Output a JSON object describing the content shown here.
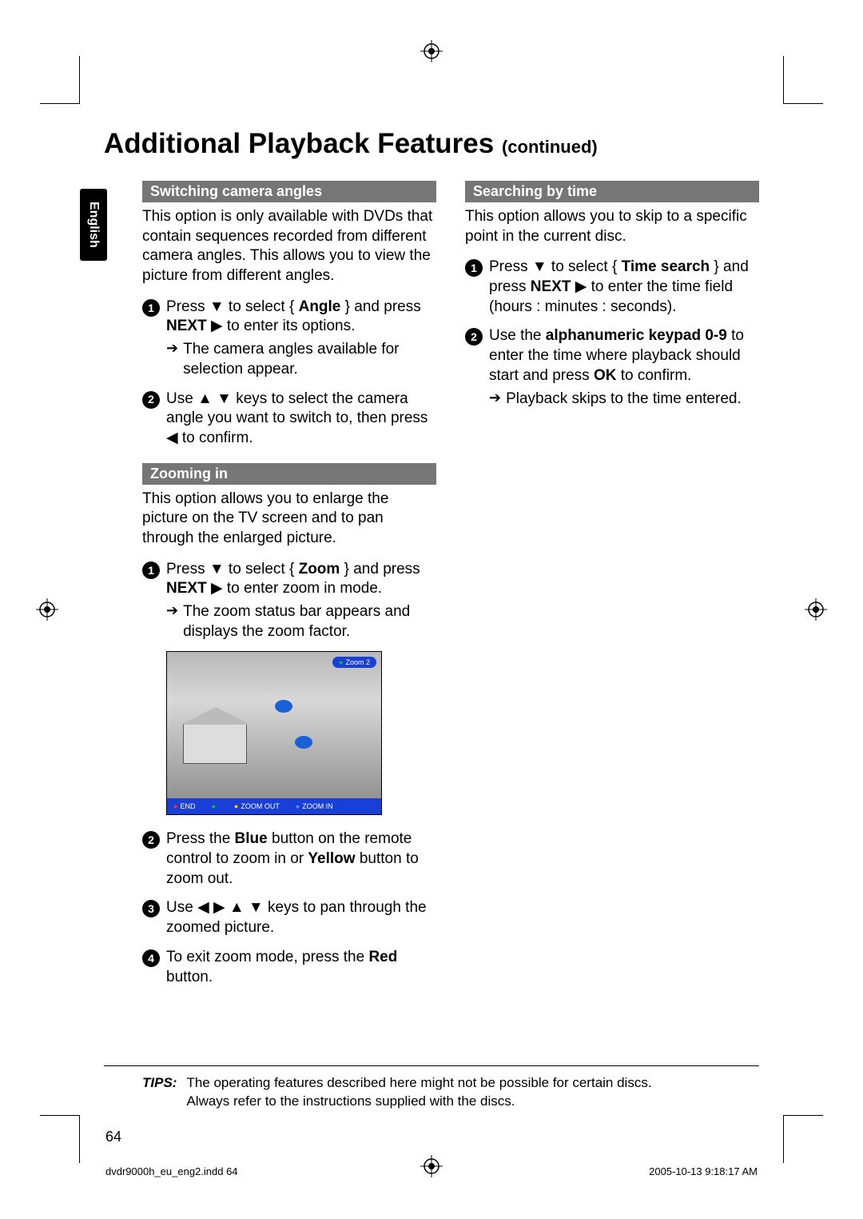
{
  "page": {
    "title_main": "Additional Playback Features",
    "title_cont": "(continued)",
    "language_tab": "English",
    "page_number": "64",
    "footer_file": "dvdr9000h_eu_eng2.indd   64",
    "footer_date": "2005-10-13   9:18:17 AM"
  },
  "tips": {
    "label": "TIPS:",
    "line1": "The operating features described here might not be possible for certain discs.",
    "line2": "Always refer to the instructions supplied with the discs."
  },
  "left": {
    "sec1_title": "Switching camera angles",
    "sec1_intro": "This option is only available with DVDs that contain sequences recorded from different camera angles. This allows you to view the picture from different angles.",
    "sec1_step1_a": "Press ▼ to select { ",
    "sec1_step1_b": "Angle",
    "sec1_step1_c": " } and press ",
    "sec1_step1_d": "NEXT",
    "sec1_step1_e": " ▶  to enter its options.",
    "sec1_step1_result": "The camera angles available for selection appear.",
    "sec1_step2": "Use ▲ ▼ keys to select the camera angle you want to switch to, then press ◀ to confirm.",
    "sec2_title": "Zooming in",
    "sec2_intro": "This option allows you to enlarge the picture on the TV screen and to pan through the enlarged picture.",
    "sec2_step1_a": "Press ▼ to select { ",
    "sec2_step1_b": "Zoom",
    "sec2_step1_c": " } and press ",
    "sec2_step1_d": "NEXT",
    "sec2_step1_e": " ▶  to enter zoom in mode.",
    "sec2_step1_result": "The zoom status bar appears and displays the zoom factor.",
    "zoom_badge": "Zoom 2",
    "zoom_end": "END",
    "zoom_out": "ZOOM OUT",
    "zoom_in": "ZOOM IN",
    "sec2_step2_a": "Press the ",
    "sec2_step2_b": "Blue",
    "sec2_step2_c": " button on the remote control to zoom in or ",
    "sec2_step2_d": "Yellow",
    "sec2_step2_e": " button to zoom out.",
    "sec2_step3": "Use ◀ ▶ ▲ ▼ keys to pan through the zoomed picture.",
    "sec2_step4_a": "To exit zoom mode, press the ",
    "sec2_step4_b": "Red",
    "sec2_step4_c": " button."
  },
  "right": {
    "sec1_title": "Searching by time",
    "sec1_intro": "This option allows you to skip to a specific point in the current disc.",
    "sec1_step1_a": "Press ▼ to select { ",
    "sec1_step1_b": "Time search",
    "sec1_step1_c": " } and press ",
    "sec1_step1_d": "NEXT",
    "sec1_step1_e": " ▶  to enter the time field (hours : minutes : seconds).",
    "sec1_step2_a": "Use the ",
    "sec1_step2_b": "alphanumeric keypad 0-9",
    "sec1_step2_c": " to enter the time where playback should start and press ",
    "sec1_step2_d": "OK",
    "sec1_step2_e": " to confirm.",
    "sec1_step2_result": "Playback skips to the time entered."
  }
}
